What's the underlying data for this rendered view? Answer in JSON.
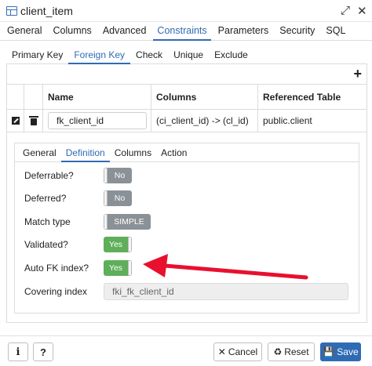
{
  "window": {
    "title": "client_item",
    "expand_icon": "⤢",
    "close_icon": "✕"
  },
  "main_tabs": [
    {
      "label": "General"
    },
    {
      "label": "Columns"
    },
    {
      "label": "Advanced"
    },
    {
      "label": "Constraints",
      "active": true
    },
    {
      "label": "Parameters"
    },
    {
      "label": "Security"
    },
    {
      "label": "SQL"
    }
  ],
  "sub_tabs": [
    {
      "label": "Primary Key"
    },
    {
      "label": "Foreign Key",
      "active": true
    },
    {
      "label": "Check"
    },
    {
      "label": "Unique"
    },
    {
      "label": "Exclude"
    }
  ],
  "grid": {
    "add_icon": "+",
    "headers": {
      "name": "Name",
      "columns": "Columns",
      "referenced_table": "Referenced Table"
    },
    "rows": [
      {
        "name": "fk_client_id",
        "columns": "(ci_client_id) -> (cl_id)",
        "referenced_table": "public.client"
      }
    ]
  },
  "detail": {
    "tabs": [
      {
        "label": "General"
      },
      {
        "label": "Definition",
        "active": true
      },
      {
        "label": "Columns"
      },
      {
        "label": "Action"
      }
    ],
    "fields": {
      "deferrable": {
        "label": "Deferrable?",
        "value": "No"
      },
      "deferred": {
        "label": "Deferred?",
        "value": "No"
      },
      "match_type": {
        "label": "Match type",
        "value": "SIMPLE"
      },
      "validated": {
        "label": "Validated?",
        "value": "Yes"
      },
      "auto_fk_index": {
        "label": "Auto FK index?",
        "value": "Yes"
      },
      "covering_index": {
        "label": "Covering index",
        "value": "fki_fk_client_id"
      }
    }
  },
  "footer": {
    "info_label": "i",
    "help_label": "?",
    "cancel_label": "Cancel",
    "reset_label": "Reset",
    "save_label": "Save"
  },
  "colors": {
    "accent": "#2f6bb5",
    "toggle_on": "#5fae5a",
    "toggle_off": "#8a9197",
    "arrow": "#e8102e"
  }
}
